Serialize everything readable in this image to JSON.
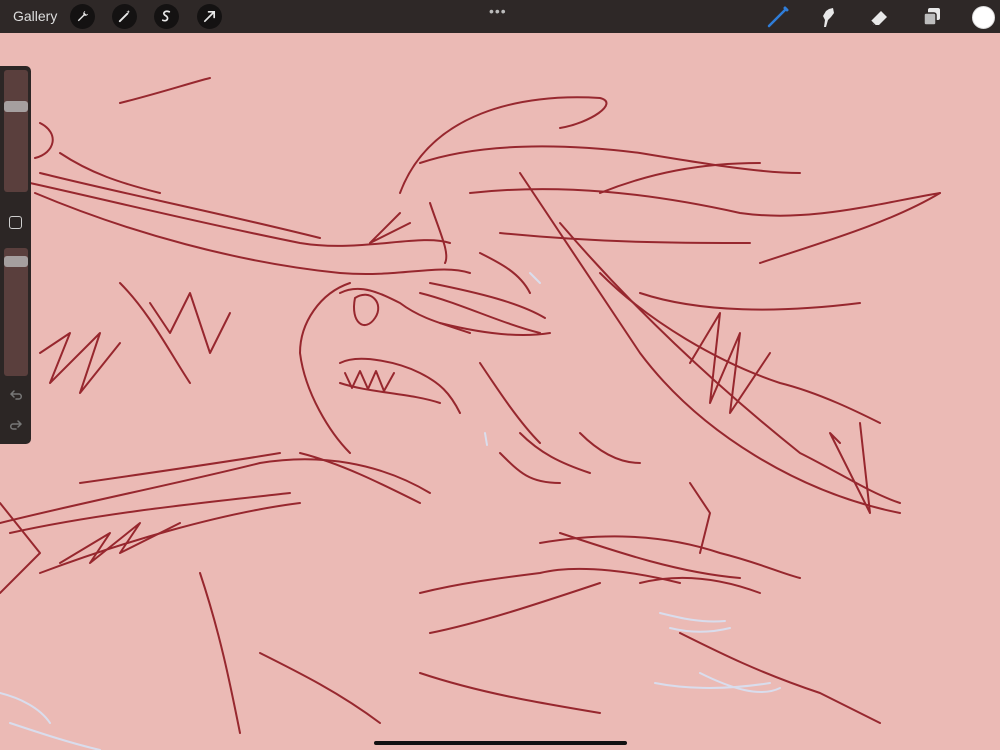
{
  "topbar": {
    "gallery_label": "Gallery",
    "left_tools": [
      "wrench-icon",
      "magic-wand-icon",
      "selection-icon",
      "transform-arrow-icon"
    ],
    "more_indicator": "•••",
    "right_tools": [
      "brush-icon",
      "smudge-icon",
      "eraser-icon",
      "layers-icon"
    ],
    "current_color": "#ffffff",
    "active_tool_color": "#2f7dd8"
  },
  "sidebar": {
    "brush_size_level": 0.72,
    "opacity_level": 0.93,
    "icons": [
      "modify-square-icon",
      "undo-icon",
      "redo-icon"
    ]
  },
  "canvas": {
    "background_color": "#ebbab5",
    "stroke_color": "#8e1820",
    "highlight_color": "#d9dff0"
  }
}
